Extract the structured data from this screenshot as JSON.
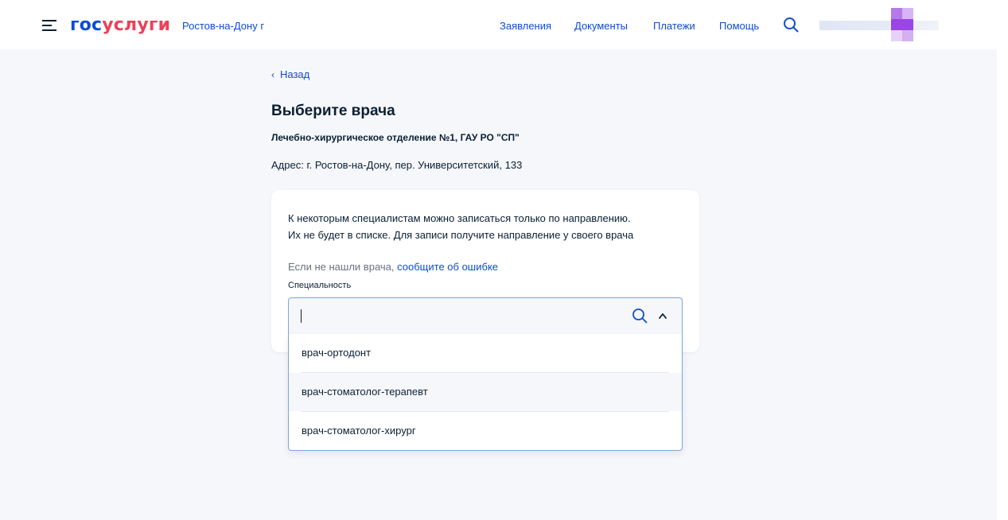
{
  "header": {
    "logo_part1": "гос",
    "logo_part2": "услуги",
    "location": "Ростов-на-Дону г",
    "nav": [
      "Заявления",
      "Документы",
      "Платежи",
      "Помощь"
    ]
  },
  "page": {
    "back_label": "Назад",
    "title": "Выберите врача",
    "subtitle": "Лечебно-хирургическое отделение №1, ГАУ РО \"СП\"",
    "address": "Адрес: г. Ростов-на-Дону, пер. Университетский, 133"
  },
  "card": {
    "info_line1": "К некоторым специалистам можно записаться только по направлению.",
    "info_line2": "Их не будет в списке. Для записи получите направление у своего врача",
    "error_text": "Если не нашли врача,",
    "error_link": "сообщите об ошибке",
    "field_label": "Специальность",
    "input_value": ""
  },
  "dropdown": {
    "options": [
      "врач-ортодонт",
      "врач-стоматолог-терапевт",
      "врач-стоматолог-хирург"
    ]
  },
  "colors": {
    "accent": "#0d4cd3",
    "brand_red": "#ee3f58",
    "text": "#0b1f33",
    "background": "#f5f7fb"
  },
  "icons": [
    "menu-icon",
    "search-icon",
    "chevron-left-icon",
    "chevron-up-icon"
  ]
}
